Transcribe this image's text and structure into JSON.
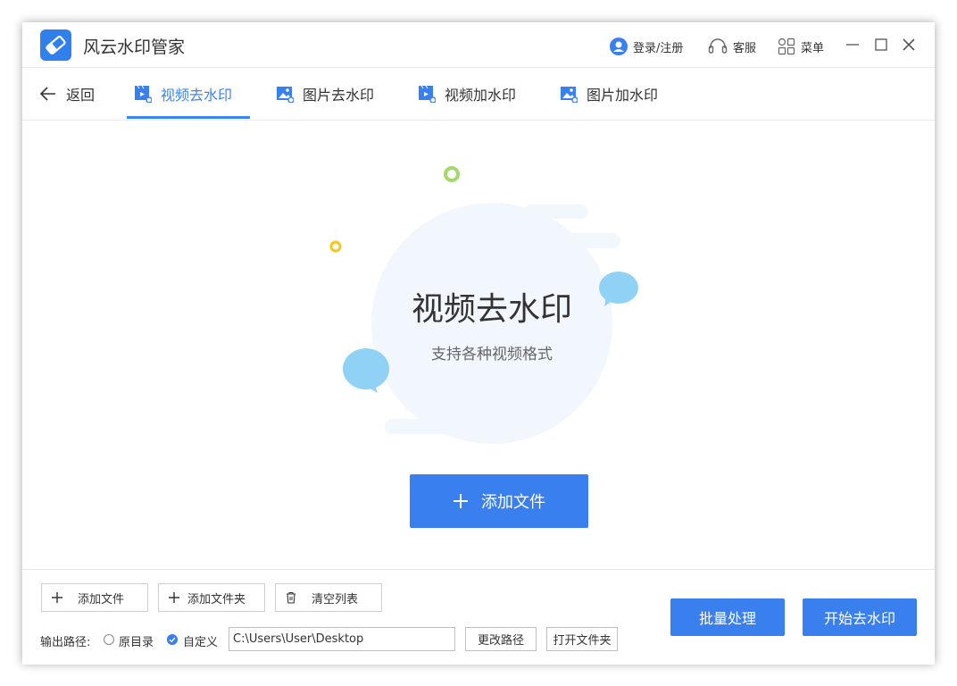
{
  "app": {
    "title": "风云水印管家"
  },
  "titlebar": {
    "login_label": "登录/注册",
    "service_label": "客服",
    "menu_label": "菜单"
  },
  "nav": {
    "back_label": "返回",
    "tabs": [
      {
        "label": "视频去水印",
        "icon": "video-icon",
        "active": true
      },
      {
        "label": "图片去水印",
        "icon": "image-icon",
        "active": false
      },
      {
        "label": "视频加水印",
        "icon": "video-icon",
        "active": false
      },
      {
        "label": "图片加水印",
        "icon": "image-icon",
        "active": false
      }
    ]
  },
  "hero": {
    "title": "视频去水印",
    "subtitle": "支持各种视频格式",
    "add_button_label": "添加文件"
  },
  "bottom": {
    "add_file_label": "添加文件",
    "add_folder_label": "添加文件夹",
    "clear_list_label": "清空列表",
    "output_label": "输出路径:",
    "option_original": "原目录",
    "option_custom": "自定义",
    "output_path": "C:\\Users\\User\\Desktop",
    "change_path_label": "更改路径",
    "open_folder_label": "打开文件夹",
    "batch_label": "批量处理",
    "start_label": "开始去水印"
  },
  "colors": {
    "accent": "#3a7fee",
    "bubble": "#8fd2f6",
    "green_dot": "#a3d96b",
    "yellow_dot": "#f5c518"
  }
}
